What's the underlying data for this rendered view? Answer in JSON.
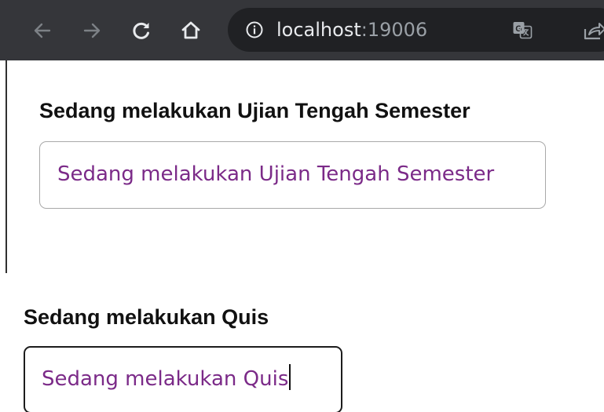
{
  "browser": {
    "url_host": "localhost",
    "url_port": ":19006",
    "toolbar_color": "#35363a",
    "omnibox_color": "#202124",
    "icons": {
      "back": "arrow-left-icon",
      "forward": "arrow-right-icon",
      "reload": "reload-icon",
      "home": "home-icon",
      "info": "info-icon",
      "translate": "translate-icon",
      "share": "share-icon"
    }
  },
  "uts": {
    "label": "Sedang melakukan Ujian Tengah Semester",
    "value": "Sedang melakukan Ujian Tengah Semester"
  },
  "quis": {
    "label": "Sedang melakukan Quis",
    "value": "Sedang melakukan Quis"
  },
  "colors": {
    "input_text": "#7b2a88",
    "label_text": "#111111",
    "focused_border": "#1c1c1c",
    "idle_border": "#a9a9a9"
  }
}
